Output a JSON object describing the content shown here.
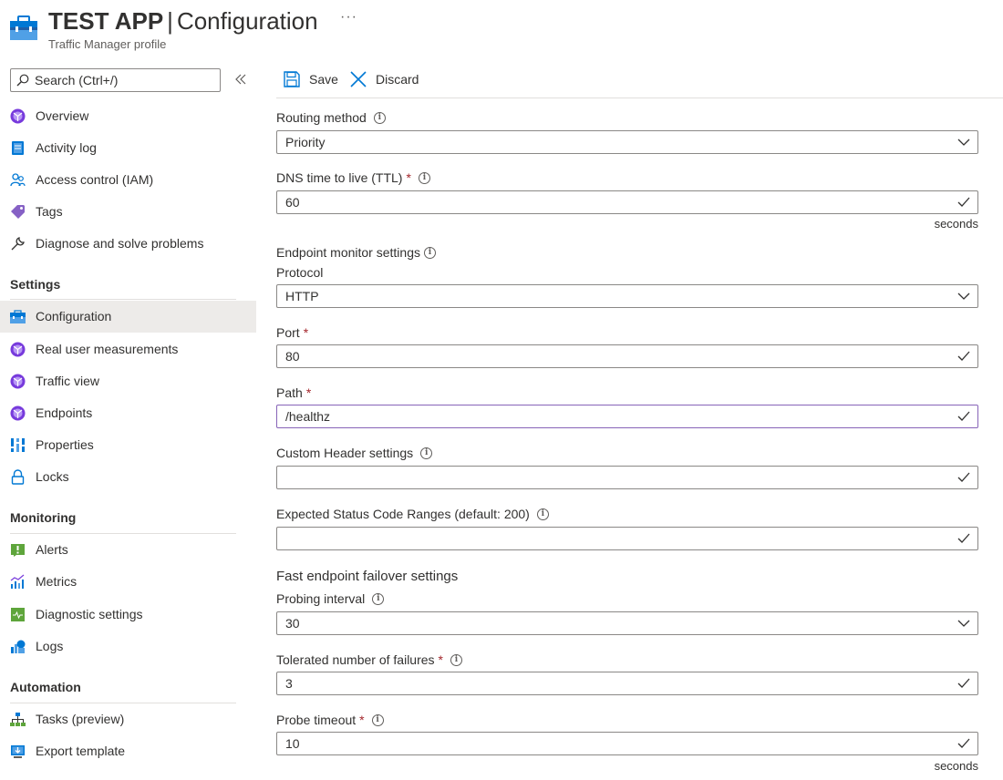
{
  "header": {
    "app_name": "TEST APP",
    "separator": "|",
    "page_name": "Configuration",
    "subtitle": "Traffic Manager profile",
    "more_label": "···"
  },
  "sidebar": {
    "search_placeholder": "Search (Ctrl+/)",
    "collapse_label": "«",
    "items_top": [
      {
        "label": "Overview",
        "icon": "traffic-manager-icon"
      },
      {
        "label": "Activity log",
        "icon": "activity-log-icon"
      },
      {
        "label": "Access control (IAM)",
        "icon": "people-icon"
      },
      {
        "label": "Tags",
        "icon": "tag-icon"
      },
      {
        "label": "Diagnose and solve problems",
        "icon": "wrench-icon"
      }
    ],
    "settings_title": "Settings",
    "settings_items": [
      {
        "label": "Configuration",
        "icon": "toolbox-icon",
        "active": true
      },
      {
        "label": "Real user measurements",
        "icon": "traffic-manager-icon"
      },
      {
        "label": "Traffic view",
        "icon": "traffic-manager-icon"
      },
      {
        "label": "Endpoints",
        "icon": "traffic-manager-icon"
      },
      {
        "label": "Properties",
        "icon": "properties-icon"
      },
      {
        "label": "Locks",
        "icon": "lock-icon"
      }
    ],
    "monitoring_title": "Monitoring",
    "monitoring_items": [
      {
        "label": "Alerts",
        "icon": "alert-icon"
      },
      {
        "label": "Metrics",
        "icon": "metrics-icon"
      },
      {
        "label": "Diagnostic settings",
        "icon": "diagnostic-icon"
      },
      {
        "label": "Logs",
        "icon": "logs-icon"
      }
    ],
    "automation_title": "Automation",
    "automation_items": [
      {
        "label": "Tasks (preview)",
        "icon": "tasks-icon"
      },
      {
        "label": "Export template",
        "icon": "export-icon"
      }
    ]
  },
  "toolbar": {
    "save_label": "Save",
    "discard_label": "Discard"
  },
  "form": {
    "routing_method": {
      "label": "Routing method",
      "value": "Priority"
    },
    "dns_ttl": {
      "label": "DNS time to live (TTL)",
      "value": "60",
      "units": "seconds"
    },
    "endpoint_monitor_title": "Endpoint monitor settings",
    "protocol": {
      "label": "Protocol",
      "value": "HTTP"
    },
    "port": {
      "label": "Port",
      "value": "80"
    },
    "path": {
      "label": "Path",
      "value": "/healthz"
    },
    "custom_header": {
      "label": "Custom Header settings",
      "value": ""
    },
    "expected_status": {
      "label": "Expected Status Code Ranges (default: 200)",
      "value": ""
    },
    "fast_failover_title": "Fast endpoint failover settings",
    "probing_interval": {
      "label": "Probing interval",
      "value": "30"
    },
    "tolerated_failures": {
      "label": "Tolerated number of failures",
      "value": "3"
    },
    "probe_timeout": {
      "label": "Probe timeout",
      "value": "10",
      "units": "seconds"
    },
    "required_mark": "*",
    "info_glyph": "i"
  },
  "colors": {
    "accent_blue": "#0078d4",
    "required_red": "#a4262c",
    "focus_purple": "#8764b8",
    "active_bg": "#edebe9"
  }
}
